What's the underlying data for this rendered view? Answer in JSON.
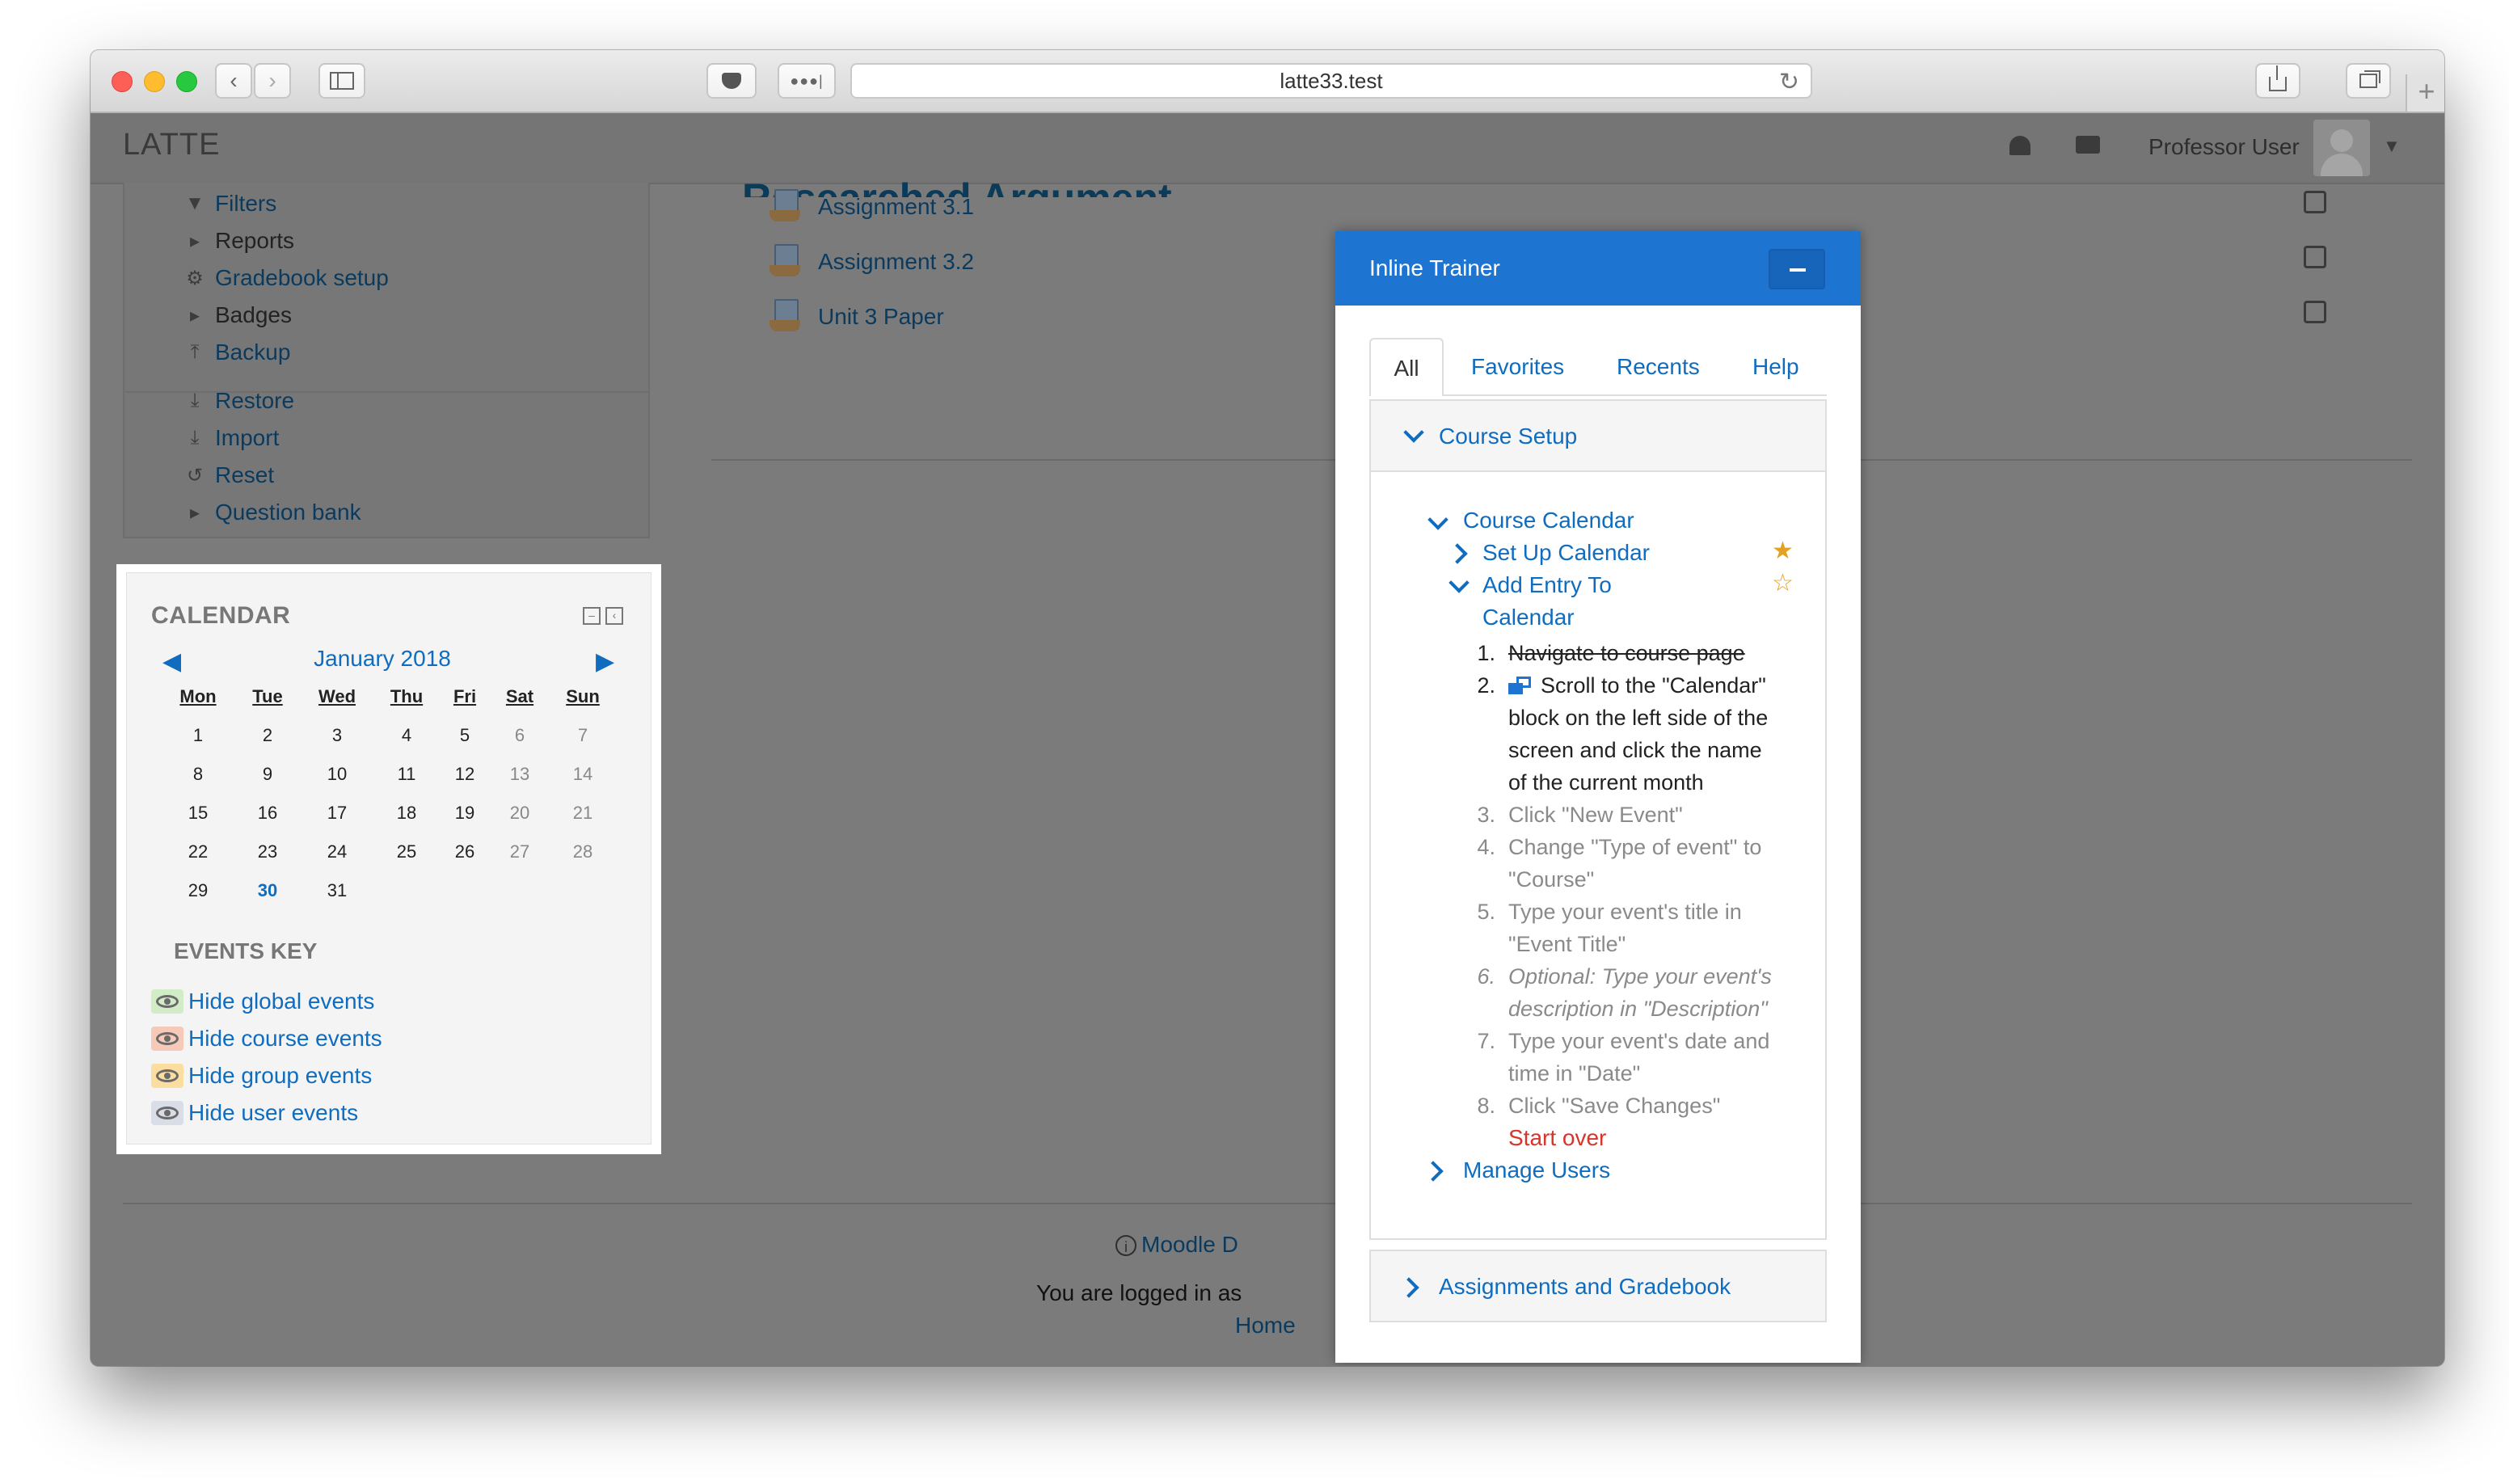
{
  "browser": {
    "url": "latte33.test",
    "icons": [
      "back-icon",
      "forward-icon",
      "sidebar-icon",
      "pocket-icon",
      "extensions-icon",
      "reload-icon",
      "share-icon",
      "tabs-icon",
      "new-tab-icon"
    ]
  },
  "navbar": {
    "brand": "LATTE",
    "user_name": "Professor User"
  },
  "admin": {
    "items": [
      {
        "label": "Filters",
        "icon": "filter-icon"
      },
      {
        "label": "Reports",
        "icon": "triangle-right-icon"
      },
      {
        "label": "Gradebook setup",
        "icon": "gear-icon"
      },
      {
        "label": "Badges",
        "icon": "triangle-right-icon"
      },
      {
        "label": "Backup",
        "icon": "upload-icon"
      },
      {
        "label": "Restore",
        "icon": "download-icon"
      },
      {
        "label": "Import",
        "icon": "download-icon"
      },
      {
        "label": "Reset",
        "icon": "reset-icon"
      },
      {
        "label": "Question bank",
        "icon": "triangle-right-icon"
      }
    ]
  },
  "main": {
    "section_title": "Researched Argument",
    "activities": [
      "Assignment 3.1",
      "Assignment 3.2",
      "Unit 3 Paper"
    ]
  },
  "calendar": {
    "title": "CALENDAR",
    "month": "January 2018",
    "days": [
      "Mon",
      "Tue",
      "Wed",
      "Thu",
      "Fri",
      "Sat",
      "Sun"
    ],
    "weeks": [
      [
        "1",
        "2",
        "3",
        "4",
        "5",
        "6",
        "7"
      ],
      [
        "8",
        "9",
        "10",
        "11",
        "12",
        "13",
        "14"
      ],
      [
        "15",
        "16",
        "17",
        "18",
        "19",
        "20",
        "21"
      ],
      [
        "22",
        "23",
        "24",
        "25",
        "26",
        "27",
        "28"
      ],
      [
        "29",
        "30",
        "31",
        "",
        "",
        "",
        ""
      ]
    ],
    "today": "30",
    "events_key_title": "EVENTS KEY",
    "events": [
      {
        "label": "Hide global events",
        "color": "#d3ecc8"
      },
      {
        "label": "Hide course events",
        "color": "#f6c9b9"
      },
      {
        "label": "Hide group events",
        "color": "#fbdda0"
      },
      {
        "label": "Hide user events",
        "color": "#d9dde8"
      }
    ]
  },
  "footer": {
    "docs_link": "Moodle D",
    "logged_in": "You are logged in as",
    "home": "Home"
  },
  "trainer": {
    "title": "Inline Trainer",
    "tabs": [
      "All",
      "Favorites",
      "Recents",
      "Help"
    ],
    "sections": {
      "course_setup": "Course Setup",
      "course_calendar": "Course Calendar",
      "set_up_calendar": "Set Up Calendar",
      "add_entry_line1": "Add Entry To",
      "add_entry_line2": "Calendar",
      "manage_users": "Manage Users",
      "assignments": "Assignments and Gradebook"
    },
    "steps": [
      {
        "num": "1.",
        "lines": [
          "Navigate to course page"
        ],
        "state": "done"
      },
      {
        "num": "2.",
        "lines": [
          "Scroll to the \"Calendar\"",
          "block on the left side of the",
          "screen and click the name",
          "of the current month"
        ],
        "state": "current"
      },
      {
        "num": "3.",
        "lines": [
          "Click \"New Event\""
        ],
        "state": "pending"
      },
      {
        "num": "4.",
        "lines": [
          "Change \"Type of event\" to",
          "\"Course\""
        ],
        "state": "pending"
      },
      {
        "num": "5.",
        "lines": [
          "Type your event's title in",
          "\"Event Title\""
        ],
        "state": "pending"
      },
      {
        "num": "6.",
        "lines": [
          "Optional: Type your event's",
          "description in \"Description\""
        ],
        "state": "optional"
      },
      {
        "num": "7.",
        "lines": [
          "Type your event's date and",
          "time in \"Date\""
        ],
        "state": "pending"
      },
      {
        "num": "8.",
        "lines": [
          "Click \"Save Changes\""
        ],
        "state": "pending"
      }
    ],
    "start_over": "Start over",
    "colors": {
      "header": "#1e74d1",
      "link": "#0f6cbf",
      "start_over": "#d9342b",
      "star": "#e5a121"
    }
  }
}
